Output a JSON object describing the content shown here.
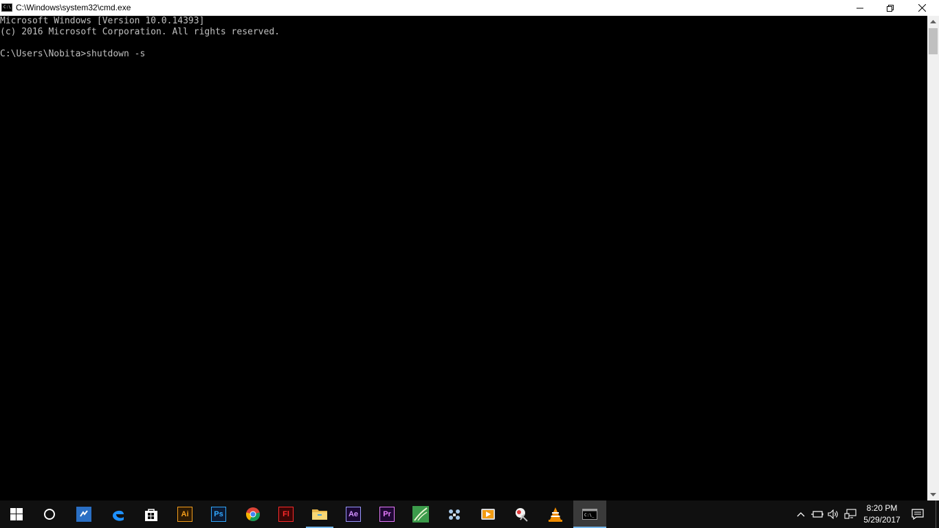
{
  "window": {
    "title": "C:\\Windows\\system32\\cmd.exe",
    "icon_glyph": "C:\\"
  },
  "console": {
    "lines": [
      "Microsoft Windows [Version 10.0.14393]",
      "(c) 2016 Microsoft Corporation. All rights reserved.",
      "",
      "C:\\Users\\Nobita>shutdown -s"
    ]
  },
  "taskbar": {
    "apps": [
      {
        "name": "start",
        "icon": "windows-logo-icon"
      },
      {
        "name": "cortana",
        "icon": "cortana-circle-icon"
      },
      {
        "name": "app-blue",
        "icon": "xtreme-download-icon"
      },
      {
        "name": "edge",
        "icon": "edge-icon"
      },
      {
        "name": "store",
        "icon": "store-icon"
      },
      {
        "name": "illustrator",
        "label": "Ai",
        "icon": "illustrator-icon"
      },
      {
        "name": "photoshop",
        "label": "Ps",
        "icon": "photoshop-icon"
      },
      {
        "name": "chrome",
        "icon": "chrome-icon"
      },
      {
        "name": "flash",
        "label": "Fl",
        "icon": "flash-icon"
      },
      {
        "name": "file-explorer",
        "icon": "folder-icon"
      },
      {
        "name": "after-effects",
        "label": "Ae",
        "icon": "after-effects-icon"
      },
      {
        "name": "premiere",
        "label": "Pr",
        "icon": "premiere-icon"
      },
      {
        "name": "green-app",
        "icon": "green-app-icon"
      },
      {
        "name": "gamepad",
        "icon": "gamepad-icon"
      },
      {
        "name": "video",
        "icon": "video-player-icon"
      },
      {
        "name": "snipping",
        "icon": "snipping-tool-icon"
      },
      {
        "name": "vlc",
        "icon": "vlc-cone-icon"
      },
      {
        "name": "cmd",
        "icon": "cmd-icon"
      }
    ],
    "clock": {
      "time": "8:20 PM",
      "date": "5/29/2017"
    }
  },
  "colors": {
    "console_text": "#c0c0c0",
    "console_bg": "#000000",
    "taskbar_bg": "#101010",
    "accent": "#76b9ed"
  }
}
